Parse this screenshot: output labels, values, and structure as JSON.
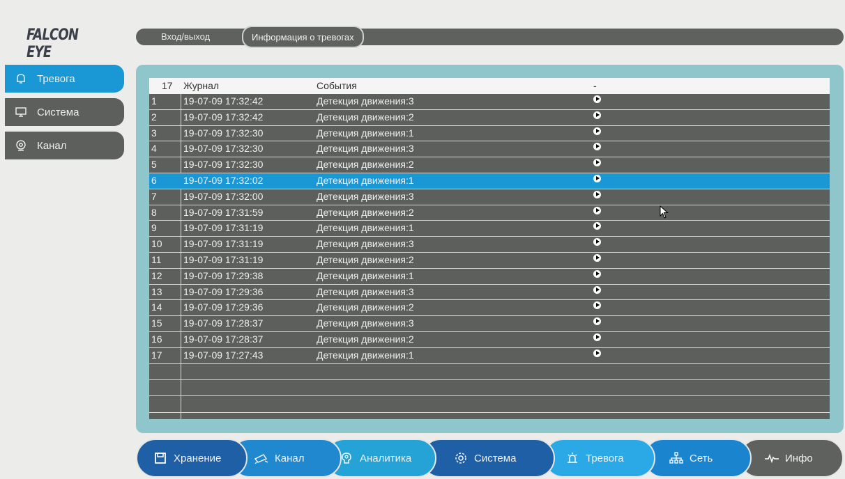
{
  "brand": {
    "logo_text": "FALCON EYE"
  },
  "tabs": [
    {
      "label": "Вход/выход"
    },
    {
      "label": "Информация о тревогах"
    }
  ],
  "sidebar": {
    "items": [
      {
        "label": "Тревога",
        "icon": "bell-icon",
        "active": true
      },
      {
        "label": "Система",
        "icon": "monitor-icon",
        "active": false
      },
      {
        "label": "Канал",
        "icon": "camera-icon",
        "active": false
      }
    ]
  },
  "table": {
    "headers": {
      "count": "17",
      "journal": "Журнал",
      "events": "События",
      "action": "-"
    },
    "selected_index": 5,
    "rows": [
      {
        "n": "1",
        "time": "19-07-09 17:32:42",
        "event": "Детекция движения:3"
      },
      {
        "n": "2",
        "time": "19-07-09 17:32:42",
        "event": "Детекция движения:2"
      },
      {
        "n": "3",
        "time": "19-07-09 17:32:30",
        "event": "Детекция движения:1"
      },
      {
        "n": "4",
        "time": "19-07-09 17:32:30",
        "event": "Детекция движения:3"
      },
      {
        "n": "5",
        "time": "19-07-09 17:32:30",
        "event": "Детекция движения:2"
      },
      {
        "n": "6",
        "time": "19-07-09 17:32:02",
        "event": "Детекция движения:1"
      },
      {
        "n": "7",
        "time": "19-07-09 17:32:00",
        "event": "Детекция движения:3"
      },
      {
        "n": "8",
        "time": "19-07-09 17:31:59",
        "event": "Детекция движения:2"
      },
      {
        "n": "9",
        "time": "19-07-09 17:31:19",
        "event": "Детекция движения:1"
      },
      {
        "n": "10",
        "time": "19-07-09 17:31:19",
        "event": "Детекция движения:3"
      },
      {
        "n": "11",
        "time": "19-07-09 17:31:19",
        "event": "Детекция движения:2"
      },
      {
        "n": "12",
        "time": "19-07-09 17:29:38",
        "event": "Детекция движения:1"
      },
      {
        "n": "13",
        "time": "19-07-09 17:29:36",
        "event": "Детекция движения:3"
      },
      {
        "n": "14",
        "time": "19-07-09 17:29:36",
        "event": "Детекция движения:2"
      },
      {
        "n": "15",
        "time": "19-07-09 17:28:37",
        "event": "Детекция движения:3"
      },
      {
        "n": "16",
        "time": "19-07-09 17:28:37",
        "event": "Детекция движения:2"
      },
      {
        "n": "17",
        "time": "19-07-09 17:27:43",
        "event": "Детекция движения:1"
      }
    ]
  },
  "bottom_nav": [
    {
      "label": "Хранение",
      "icon": "save-icon",
      "color": "#1f5fa6"
    },
    {
      "label": "Канал",
      "icon": "camera-icon",
      "color": "#2088cf"
    },
    {
      "label": "Аналитика",
      "icon": "brain-icon",
      "color": "#25a2d6"
    },
    {
      "label": "Система",
      "icon": "gear-icon",
      "color": "#1f5fa6"
    },
    {
      "label": "Тревога",
      "icon": "siren-icon",
      "color": "#2aa9e6"
    },
    {
      "label": "Сеть",
      "icon": "network-icon",
      "color": "#1b84cf"
    },
    {
      "label": "Инфо",
      "icon": "pulse-icon",
      "color": "#5f615e"
    }
  ],
  "colors": {
    "accent": "#1a98d5",
    "panel": "#8ec6cb",
    "table_bg": "#5d5f5c"
  }
}
